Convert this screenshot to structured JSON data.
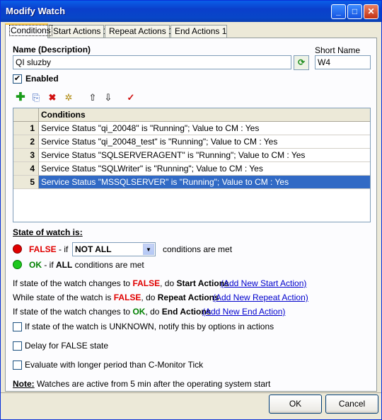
{
  "window": {
    "title": "Modify Watch"
  },
  "tabs": [
    {
      "label": "Conditions"
    },
    {
      "label": "Start Actions 1"
    },
    {
      "label": "Repeat Actions 1"
    },
    {
      "label": "End Actions 1"
    }
  ],
  "form": {
    "name_label": "Name (Description)",
    "name_value": "QI sluzby",
    "short_name_label": "Short Name",
    "short_name_value": "W4",
    "enabled_label": "Enabled",
    "enabled_checked": true
  },
  "toolbar_icons": [
    "add-icon",
    "copy-icon",
    "delete-icon",
    "settings-icon",
    "move-up-icon",
    "move-down-icon",
    "check-icon"
  ],
  "grid": {
    "header": "Conditions",
    "rows": [
      {
        "num": "1",
        "text": "Service Status \"qi_20048\" is \"Running\"; Value to CM : Yes"
      },
      {
        "num": "2",
        "text": "Service Status \"qi_20048_test\" is \"Running\"; Value to CM : Yes"
      },
      {
        "num": "3",
        "text": "Service Status \"SQLSERVERAGENT\" is \"Running\"; Value to CM : Yes"
      },
      {
        "num": "4",
        "text": "Service Status \"SQLWriter\" is \"Running\"; Value to CM : Yes"
      },
      {
        "num": "5",
        "text": "Service Status \"MSSQLSERVER\" is \"Running\"; Value to CM : Yes"
      }
    ],
    "selected_row": 5
  },
  "state": {
    "heading": "State of watch is:",
    "false_word": "FALSE",
    "false_if": " - if",
    "select_value": "NOT ALL",
    "conditions_met": "conditions are met",
    "ok_word": "OK",
    "ok_if": " - if ",
    "ok_all": "ALL",
    "ok_rest": " conditions are met"
  },
  "actions": {
    "line1_a": "If state of the watch changes to ",
    "line1_b": "FALSE",
    "line1_c": ", do ",
    "line1_d": "Start Actions",
    "line1_link": "(Add New Start Action)",
    "line2_a": "While state of the watch is ",
    "line2_b": "FALSE",
    "line2_c": ", do ",
    "line2_d": "Repeat Actions",
    "line2_link": "(Add New Repeat Action)",
    "line3_a": "If state of the watch changes to ",
    "line3_b": "OK",
    "line3_c": ", do ",
    "line3_d": "End Actions",
    "line3_link": "(Add New End Action)"
  },
  "options": {
    "unknown_label": "If state of the watch is UNKNOWN, notify this by options in actions",
    "delay_label": "Delay for FALSE state",
    "evaluate_label": "Evaluate with longer period than C-Monitor Tick"
  },
  "note": {
    "prefix": "Note:",
    "text": " Watches are active from 5 min after the operating system start"
  },
  "buttons": {
    "ok": "OK",
    "cancel": "Cancel"
  }
}
